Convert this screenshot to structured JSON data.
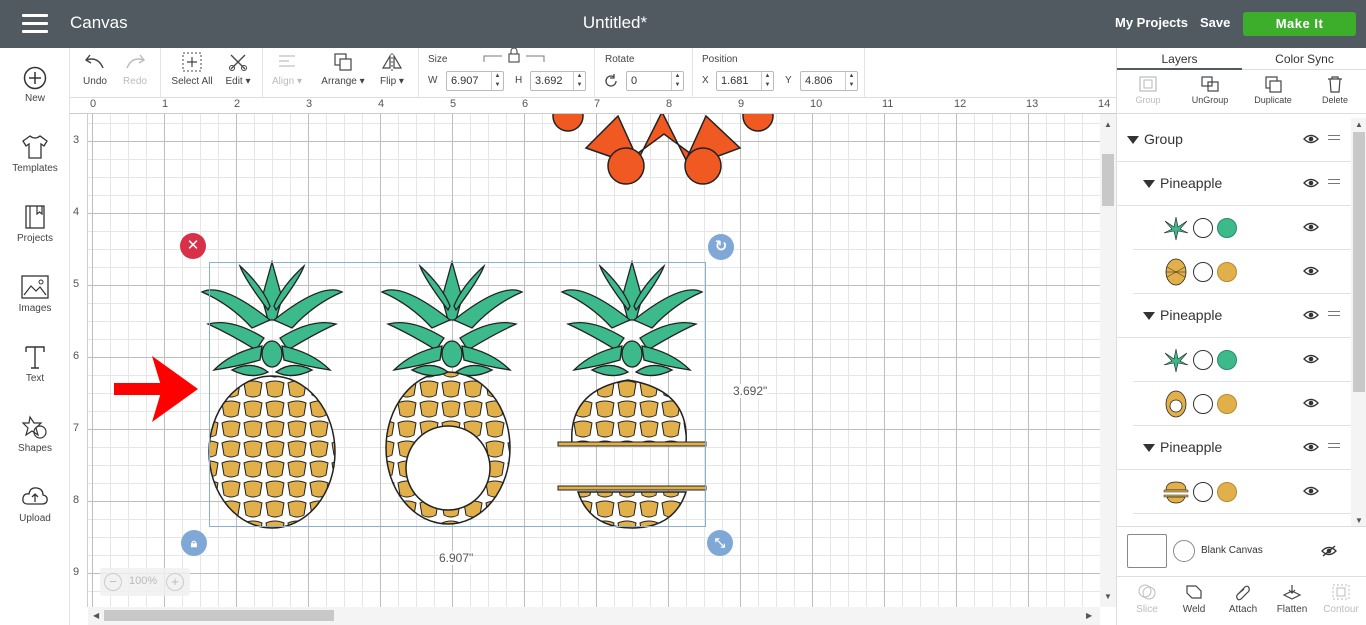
{
  "topbar": {
    "app_title": "Canvas",
    "doc_title": "Untitled*",
    "my_projects": "My Projects",
    "save": "Save",
    "make_it": "Make It"
  },
  "leftbar": {
    "new": "New",
    "templates": "Templates",
    "projects": "Projects",
    "images": "Images",
    "text": "Text",
    "shapes": "Shapes",
    "upload": "Upload"
  },
  "toolbar": {
    "undo": "Undo",
    "redo": "Redo",
    "select_all": "Select All",
    "edit": "Edit",
    "align": "Align",
    "arrange": "Arrange",
    "flip": "Flip",
    "size_label": "Size",
    "w_label": "W",
    "w_value": "6.907",
    "h_label": "H",
    "h_value": "3.692",
    "rotate_label": "Rotate",
    "rotate_value": "0",
    "position_label": "Position",
    "x_label": "X",
    "x_value": "1.681",
    "y_label": "Y",
    "y_value": "4.806"
  },
  "rulers": {
    "top": [
      "0",
      "1",
      "2",
      "3",
      "4",
      "5",
      "6",
      "7",
      "8",
      "9",
      "10",
      "11",
      "12",
      "13",
      "14"
    ],
    "left": [
      "3",
      "4",
      "5",
      "6",
      "7",
      "8",
      "9"
    ]
  },
  "canvas": {
    "width_label": "6.907\"",
    "height_label": "3.692\"",
    "zoom": "100%"
  },
  "right_panel": {
    "tab_layers": "Layers",
    "tab_color_sync": "Color Sync",
    "group": "Group",
    "ungroup": "UnGroup",
    "duplicate": "Duplicate",
    "delete": "Delete",
    "layers": [
      {
        "name": "Group"
      },
      {
        "name": "Pineapple"
      },
      {
        "name": "Pineapple"
      },
      {
        "name": "Pineapple"
      }
    ],
    "blank_canvas": "Blank Canvas",
    "slice": "Slice",
    "weld": "Weld",
    "attach": "Attach",
    "flatten": "Flatten",
    "contour": "Contour"
  },
  "colors": {
    "topbar": "#505a60",
    "make_it": "#3dae2b",
    "leaf_green": "#3dba8c",
    "pineapple_gold": "#e2b04a",
    "flower_orange": "#f05a22",
    "arrow_red": "#ff0000",
    "delete_handle": "#d9304a",
    "handle_blue": "#7fa8d6"
  }
}
